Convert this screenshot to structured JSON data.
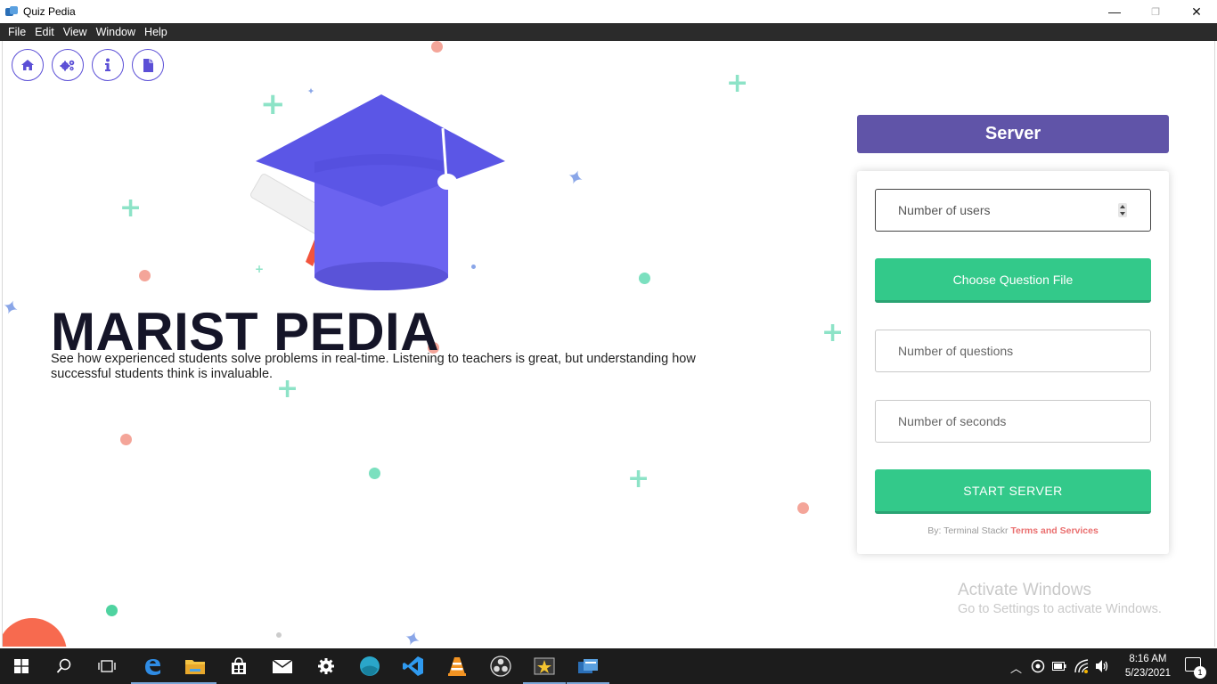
{
  "window": {
    "title": "Quiz Pedia",
    "minimize_glyph": "—",
    "maximize_glyph": "❐",
    "close_glyph": "✕"
  },
  "menu": [
    "File",
    "Edit",
    "View",
    "Window",
    "Help"
  ],
  "nav_icons": [
    "home-icon",
    "cogs-icon",
    "info-icon",
    "file-icon"
  ],
  "hero": {
    "title": "MARIST PEDIA",
    "description": "See how experienced students solve problems in real-time. Listening to teachers is great, but understanding how successful students think is invaluable."
  },
  "server": {
    "header": "Server",
    "users_placeholder": "Number of users",
    "choose_file_label": "Choose Question File",
    "questions_placeholder": "Number of questions",
    "seconds_placeholder": "Number of seconds",
    "start_label": "START SERVER",
    "credit_prefix": "By: Terminal Stackr",
    "credit_link": "Terms and Services"
  },
  "activation": {
    "title": "Activate Windows",
    "subtitle": "Go to Settings to activate Windows."
  },
  "taskbar": {
    "time": "8:16 AM",
    "date": "5/23/2021",
    "notification_count": "1"
  },
  "colors": {
    "accent_purple": "#6054a8",
    "green": "#33c98a",
    "link_red": "#ea6f6f",
    "cap_purple": "#6b63f0"
  }
}
